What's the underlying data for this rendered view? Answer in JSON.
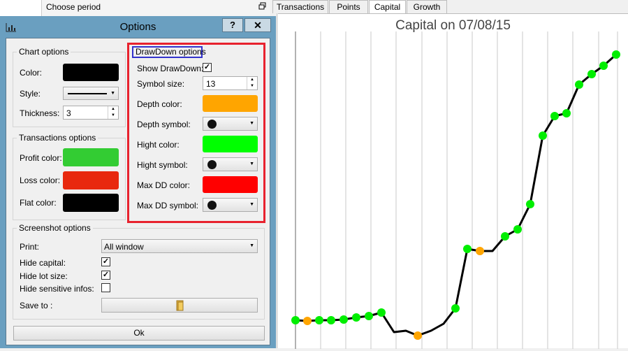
{
  "app": {
    "period_title": "Choose period",
    "tabs": [
      {
        "label": "Transactions",
        "active": false
      },
      {
        "label": "Points",
        "active": false
      },
      {
        "label": "Capital",
        "active": true
      },
      {
        "label": "Growth",
        "active": false
      }
    ]
  },
  "dialog": {
    "title": "Options",
    "help_label": "?",
    "close_label": "✕",
    "chart_options": {
      "title": "Chart options",
      "color_label": "Color:",
      "color": "#000000",
      "style_label": "Style:",
      "thickness_label": "Thickness:",
      "thickness": "3"
    },
    "transactions_options": {
      "title": "Transactions options",
      "profit_label": "Profit color:",
      "profit_color": "#33cc33",
      "loss_label": "Loss color:",
      "loss_color": "#e8280e",
      "flat_label": "Flat color:",
      "flat_color": "#000000"
    },
    "drawdown_options": {
      "title": "DrawDown options",
      "show_label": "Show DrawDown:",
      "show_checked": true,
      "symbol_size_label": "Symbol size:",
      "symbol_size": "13",
      "depth_color_label": "Depth color:",
      "depth_color": "#ffa500",
      "depth_symbol_label": "Depth symbol:",
      "hight_color_label": "Hight color:",
      "hight_color": "#00ff00",
      "hight_symbol_label": "Hight symbol:",
      "maxdd_color_label": "Max DD color:",
      "maxdd_color": "#ff0000",
      "maxdd_symbol_label": "Max DD symbol:"
    },
    "screenshot_options": {
      "title": "Screenshot options",
      "print_label": "Print:",
      "print_value": "All window",
      "hide_capital_label": "Hide capital:",
      "hide_capital": true,
      "hide_lot_label": "Hide lot size:",
      "hide_lot": true,
      "hide_sensitive_label": "Hide sensitive infos:",
      "hide_sensitive": false,
      "save_to_label": "Save to :",
      "folder_icon": "folder-icon"
    },
    "ok_label": "Ok",
    "highlight_colors": {
      "outer": "#e8222e",
      "inner": "#3333cc"
    }
  },
  "chart": {
    "title": "Capital on 07/08/15",
    "grid": "vertical lines",
    "line_color": "#000000",
    "markers": [
      {
        "status": "hight",
        "color": "#00ee00"
      },
      {
        "status": "depth",
        "color": "#ffa500"
      },
      {
        "status": "hight",
        "color": "#00ee00"
      },
      {
        "status": "hight",
        "color": "#00ee00"
      },
      {
        "status": "hight",
        "color": "#00ee00"
      },
      {
        "status": "hight",
        "color": "#00ee00"
      },
      {
        "status": "hight",
        "color": "#00ee00"
      },
      {
        "status": "hight",
        "color": "#00ee00"
      },
      {
        "status": "none"
      },
      {
        "status": "none"
      },
      {
        "status": "depth",
        "color": "#ffa500"
      },
      {
        "status": "none"
      },
      {
        "status": "none"
      },
      {
        "status": "hight",
        "color": "#00ee00"
      },
      {
        "status": "hight",
        "color": "#00ee00"
      },
      {
        "status": "depth",
        "color": "#ffa500"
      },
      {
        "status": "none"
      },
      {
        "status": "hight",
        "color": "#00ee00"
      },
      {
        "status": "hight",
        "color": "#00ee00"
      },
      {
        "status": "hight",
        "color": "#00ee00"
      },
      {
        "status": "hight",
        "color": "#00ee00"
      },
      {
        "status": "hight",
        "color": "#00ee00"
      },
      {
        "status": "hight",
        "color": "#00ee00"
      },
      {
        "status": "hight",
        "color": "#00ee00"
      },
      {
        "status": "hight",
        "color": "#00ee00"
      },
      {
        "status": "hight",
        "color": "#00ee00"
      },
      {
        "status": "hight",
        "color": "#00ee00"
      },
      {
        "status": "hight",
        "color": "#00ee00"
      }
    ]
  }
}
